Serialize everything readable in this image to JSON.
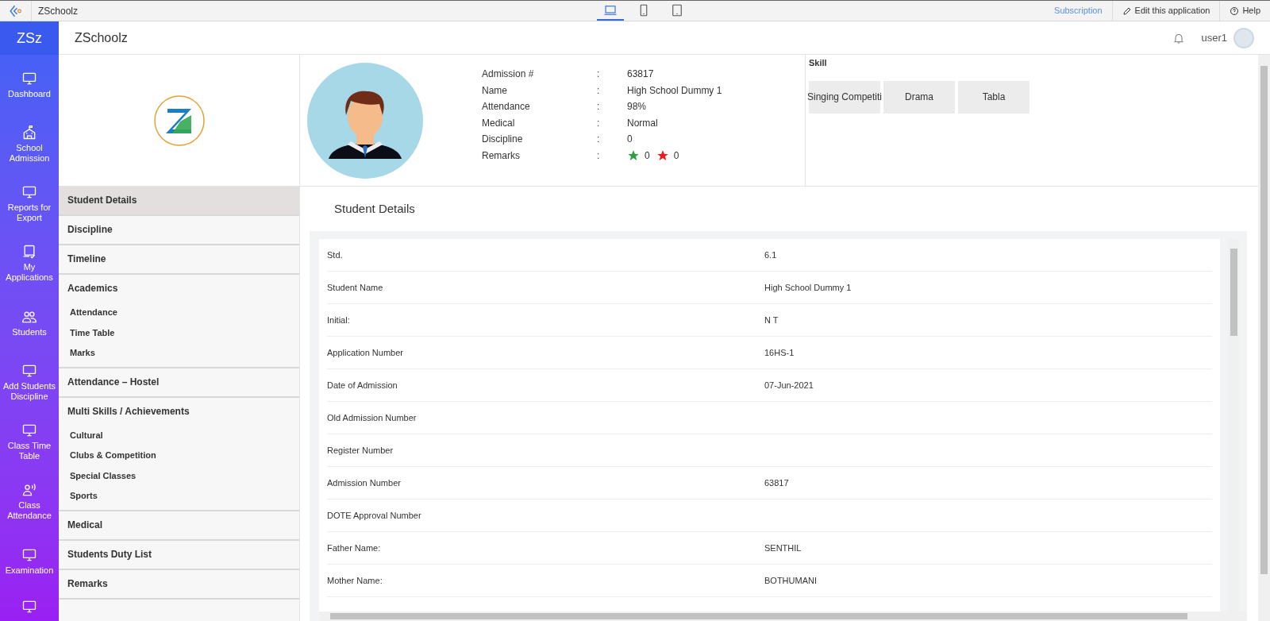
{
  "top_bar": {
    "app_name": "ZSchoolz",
    "devices": [
      {
        "kind": "laptop",
        "selected": true
      },
      {
        "kind": "phone",
        "selected": false
      },
      {
        "kind": "tablet",
        "selected": false
      }
    ],
    "subscription": "Subscription",
    "edit": "Edit this application",
    "help": "Help"
  },
  "sidebar": {
    "brand": "ZSz",
    "items": [
      {
        "label": "Dashboard",
        "kind": "monitor"
      },
      {
        "label": "School Admission",
        "kind": "school"
      },
      {
        "label": "Reports for Export",
        "kind": "monitor"
      },
      {
        "label": "My Applications",
        "kind": "check-screen"
      },
      {
        "label": "Students",
        "kind": "people"
      },
      {
        "label": "Add Students Discipline",
        "kind": "monitor"
      },
      {
        "label": "Class Time Table",
        "kind": "monitor"
      },
      {
        "label": "Class Attendance",
        "kind": "speaker"
      },
      {
        "label": "Examination",
        "kind": "monitor"
      },
      {
        "kind": "monitor"
      }
    ]
  },
  "header": {
    "title": "ZSchoolz",
    "user": "user1"
  },
  "profile": {
    "info": [
      {
        "label": "Admission #",
        "value": "63817"
      },
      {
        "label": "Name",
        "value": "High School Dummy 1"
      },
      {
        "label": "Attendance",
        "value": "98%"
      },
      {
        "label": "Medical",
        "value": "Normal"
      },
      {
        "label": "Discipline",
        "value": "0"
      }
    ],
    "remarks": {
      "label": "Remarks",
      "counts": [
        {
          "color": "#2e9e3e",
          "count": "0"
        },
        {
          "color": "#ee1c1c",
          "count": "0"
        }
      ]
    },
    "separator": ":"
  },
  "skills": {
    "title": "Skill",
    "items": [
      "Singing Competiti",
      "Drama",
      "Tabla"
    ]
  },
  "menu": [
    {
      "label": "Student Details",
      "selected": true
    },
    {
      "label": "Discipline",
      "selected": false
    },
    {
      "label": "Timeline",
      "selected": false
    },
    {
      "label": "Academics",
      "selected": false,
      "children": [
        {
          "label": "Attendance"
        },
        {
          "label": "Time Table"
        },
        {
          "label": "Marks"
        }
      ]
    },
    {
      "label": "Attendance – Hostel",
      "selected": false
    },
    {
      "label": "Multi Skills / Achievements",
      "selected": false,
      "children": [
        {
          "label": "Cultural"
        },
        {
          "label": "Clubs & Competition"
        },
        {
          "label": "Special Classes"
        },
        {
          "label": "Sports"
        }
      ]
    },
    {
      "label": "Medical",
      "selected": false
    },
    {
      "label": "Students Duty List",
      "selected": false
    },
    {
      "label": "Remarks",
      "selected": false
    }
  ],
  "details": {
    "title": "Student Details",
    "rows": [
      {
        "label": "Std.",
        "value": "6.1"
      },
      {
        "label": "Student Name",
        "value": "High School Dummy 1"
      },
      {
        "label": "Initial:",
        "value": "N T"
      },
      {
        "label": "Application Number",
        "value": "16HS-1"
      },
      {
        "label": "Date of Admission",
        "value": "07-Jun-2021"
      },
      {
        "label": "Old Admission Number"
      },
      {
        "label": "Register Number"
      },
      {
        "label": "Admission Number",
        "value": "63817"
      },
      {
        "label": "DOTE Approval Number"
      },
      {
        "label": "Father Name:",
        "value": "SENTHIL"
      },
      {
        "label": "Mother Name:",
        "value": "BOTHUMANI"
      }
    ]
  }
}
